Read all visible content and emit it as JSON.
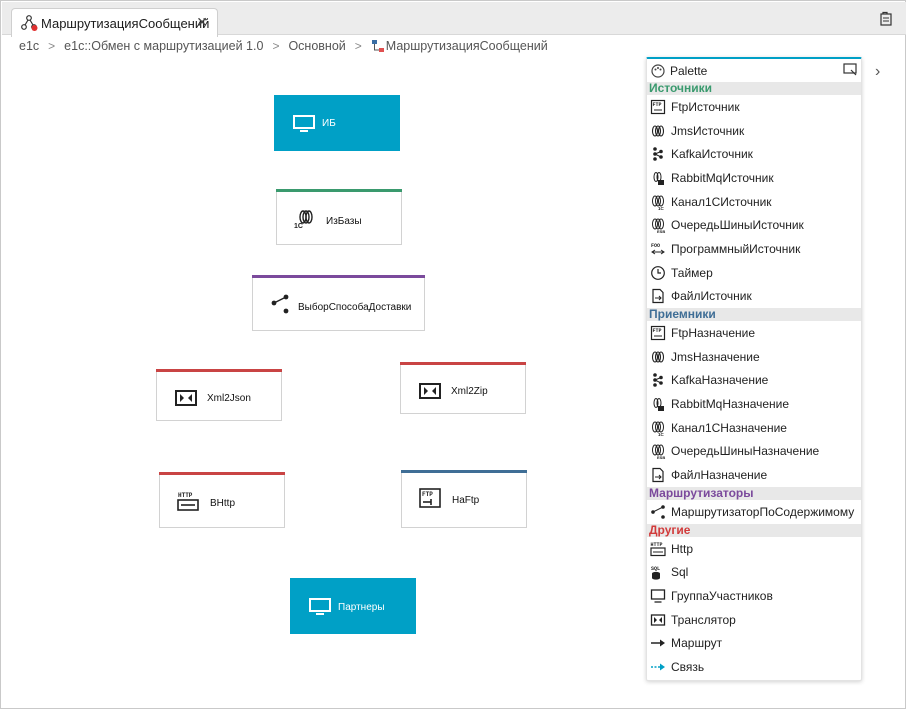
{
  "tab": {
    "title": "МаршрутизацияСообщений",
    "close": "✕"
  },
  "breadcrumb": [
    "e1c",
    "e1c::Обмен с маршрутизацией 1.0",
    "Основной",
    "МаршрутизацияСообщений"
  ],
  "nodes": {
    "ib": "ИБ",
    "izbazy": "ИзБазы",
    "vybor": "ВыборСпособаДоставки",
    "xml2json": "Xml2Json",
    "xml2zip": "Xml2Zip",
    "vhttp": "ВHttp",
    "naftp": "НаFtp",
    "partnery": "Партнеры"
  },
  "colors": {
    "system": "#00a0c6",
    "source": "#3a9a6e",
    "router": "#7b4a9c",
    "other": "#c94444",
    "receiver": "#3f6e96"
  },
  "palette": {
    "title": "Palette",
    "groups": [
      {
        "name": "Источники",
        "color": "#3a9a6e",
        "items": [
          "FtpИсточник",
          "JmsИсточник",
          "KafkaИсточник",
          "RabbitMqИсточник",
          "Канал1СИсточник",
          "ОчередьШиныИсточник",
          "ПрограммныйИсточник",
          "Таймер",
          "ФайлИсточник"
        ]
      },
      {
        "name": "Приемники",
        "color": "#3f6e96",
        "items": [
          "FtpНазначение",
          "JmsНазначение",
          "KafkaНазначение",
          "RabbitMqНазначение",
          "Канал1СНазначение",
          "ОчередьШиныНазначение",
          "ФайлНазначение"
        ]
      },
      {
        "name": "Маршрутизаторы",
        "color": "#7b4a9c",
        "items": [
          "МаршрутизаторПоСодержимому"
        ]
      },
      {
        "name": "Другие",
        "color": "#d23b3b",
        "items": [
          "Http",
          "Sql",
          "ГруппаУчастников",
          "Транслятор",
          "Маршрут",
          "Связь"
        ]
      }
    ]
  }
}
